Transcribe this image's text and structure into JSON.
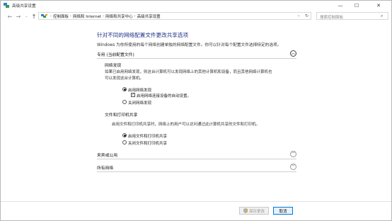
{
  "window": {
    "title": "高级共享设置",
    "min_glyph": "—",
    "max_glyph": "☐",
    "close_glyph": "✕"
  },
  "nav": {
    "back_glyph": "←",
    "forward_glyph": "→",
    "recent_glyph": "⌄",
    "up_glyph": "↑",
    "breadcrumbs": [
      "控制面板",
      "网络和 Internet",
      "网络和共享中心",
      "高级共享设置"
    ],
    "crumb_separator": "›",
    "dropdown_glyph": "⌄",
    "refresh_glyph": "↻",
    "search_placeholder": "搜索控制面板",
    "search_glyph": "⌕"
  },
  "main": {
    "heading": "针对不同的网络配置文件更改共享选项",
    "description": "Windows 为你所使用的每个网络创建单独的网络配置文件。你可以针对每个配置文件选择特定的选项。"
  },
  "profiles": {
    "private": {
      "title": "专用 (当前配置文件)",
      "expanded": true,
      "chevron": "︿"
    },
    "guest": {
      "title": "来宾或公用",
      "expanded": false,
      "chevron": "﹀"
    },
    "all": {
      "title": "所有网络",
      "expanded": false,
      "chevron": "﹀"
    }
  },
  "network_discovery": {
    "title": "网络发现",
    "description_line1": "如果已启用网络发现，则这台计算机可以发现网络上的其他计算机和设备，而且其他网络计算机也",
    "description_line2": "可以发现这台计算机。",
    "option_on": "启用网络发现",
    "option_auto_setup": "启用网络连接设备的自动设置。",
    "option_off": "关闭网络发现",
    "selected": "on",
    "auto_setup_checked": true,
    "check_glyph": "✓"
  },
  "file_printer_sharing": {
    "title": "文件和打印机共享",
    "description": "启用文件和打印机共享时，网络上的用户可以访问通过此计算机共享的文件和打印机。",
    "option_on": "启用文件和打印机共享",
    "option_off": "关闭文件和打印机共享",
    "selected": "on"
  },
  "footer": {
    "save_label": "保存更改",
    "cancel_label": "取消"
  },
  "colors": {
    "heading": "#1e3287",
    "cancel_border": "#0078d7",
    "cancel_bg": "#e5f1fb"
  }
}
